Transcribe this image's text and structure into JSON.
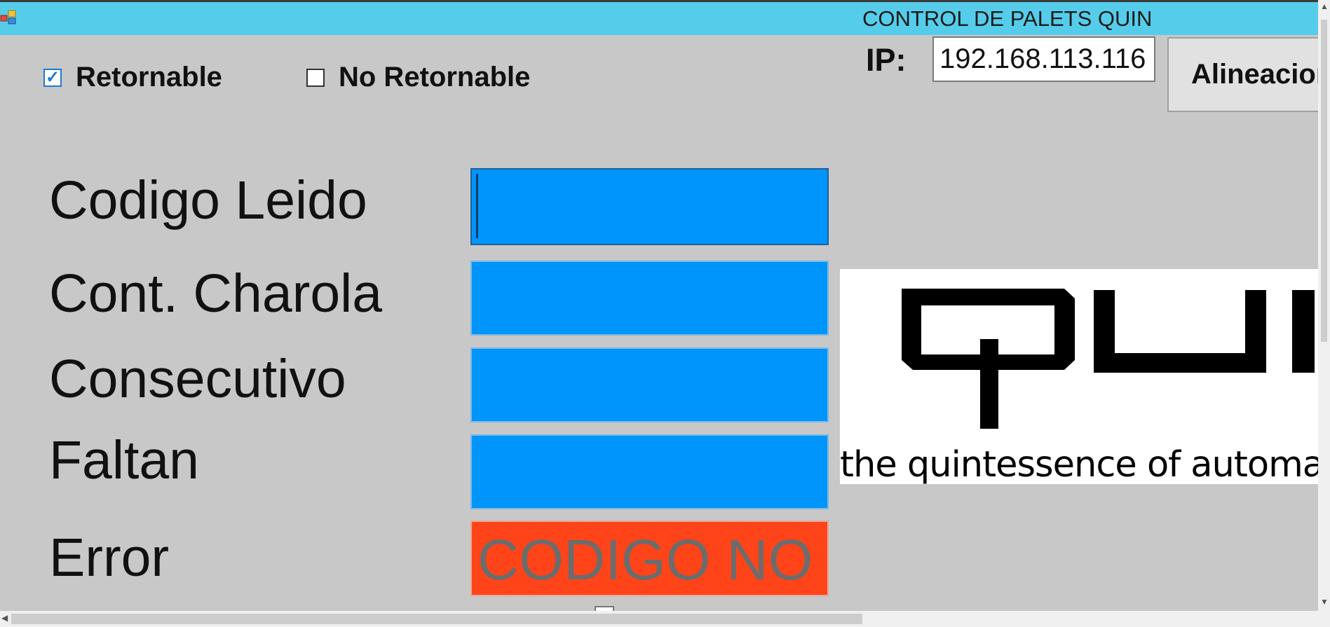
{
  "window": {
    "title": "CONTROL DE PALETS QUIN",
    "icon": "app-window-icon"
  },
  "options": {
    "retornable": {
      "label": "Retornable",
      "checked": true
    },
    "no_retornable": {
      "label": "No Retornable",
      "checked": false
    }
  },
  "ip": {
    "label": "IP:",
    "value": "192.168.113.116"
  },
  "buttons": {
    "alineacion": "Alineacion"
  },
  "fields": {
    "codigo_leido": {
      "label": "Codigo Leido",
      "value": ""
    },
    "cont_charola": {
      "label": "Cont. Charola",
      "value": ""
    },
    "consecutivo": {
      "label": "Consecutivo",
      "value": ""
    },
    "faltan": {
      "label": "Faltan",
      "value": ""
    },
    "error": {
      "label": "Error",
      "value": "CODIGO NO"
    }
  },
  "logo": {
    "text": "QUIN",
    "tagline": "the quintessence of automation"
  },
  "colors": {
    "titlebar": "#55cdea",
    "background": "#c8c8c8",
    "field": "#0095fb",
    "error": "#ff4419",
    "error_text": "#6c6c6c"
  }
}
